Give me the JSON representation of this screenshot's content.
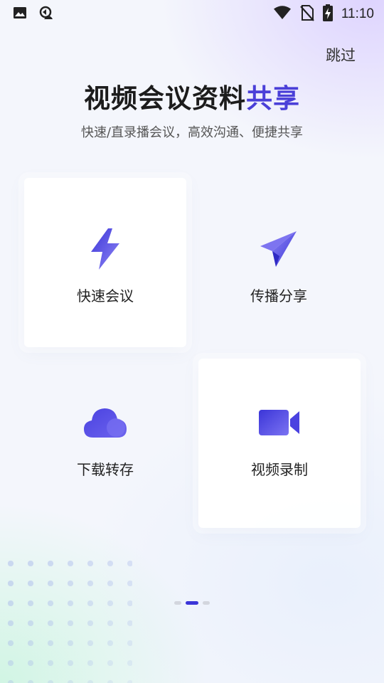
{
  "status_bar": {
    "time": "11:10",
    "left_icons": [
      "image-icon",
      "app-notification-icon"
    ],
    "right_icons": [
      "wifi-icon",
      "no-sim-icon",
      "battery-charging-icon"
    ]
  },
  "skip_label": "跳过",
  "title": {
    "main": "视频会议资料",
    "highlight": "共享",
    "highlight_color": "#4a3fd8"
  },
  "subtitle": "快速/直录播会议，高效沟通、便捷共享",
  "features": [
    {
      "label": "快速会议",
      "icon": "lightning-icon"
    },
    {
      "label": "传播分享",
      "icon": "paper-plane-icon"
    },
    {
      "label": "下载转存",
      "icon": "cloud-icon"
    },
    {
      "label": "视频录制",
      "icon": "video-camera-icon"
    }
  ],
  "pager": {
    "total": 3,
    "active_index": 1
  },
  "colors": {
    "accent": "#3b35d8",
    "accent_light": "#7b73f2"
  }
}
